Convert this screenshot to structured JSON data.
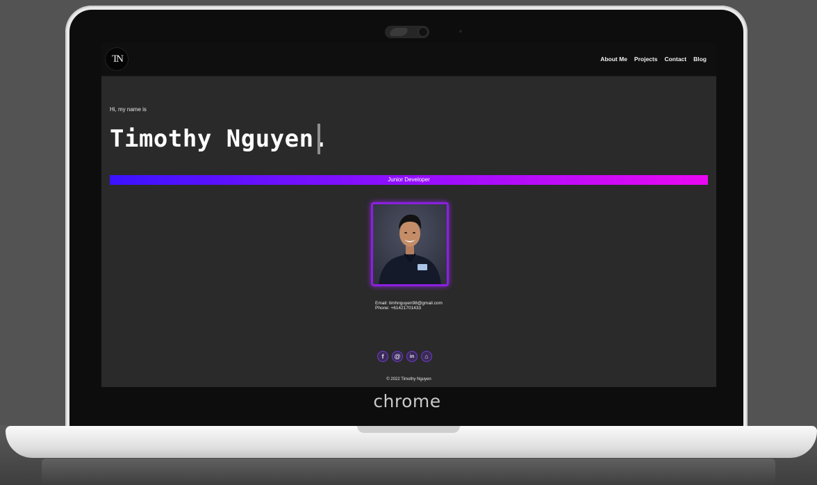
{
  "device": {
    "brand": "chrome"
  },
  "site": {
    "logo_text": "TN",
    "nav": [
      "About Me",
      "Projects",
      "Contact",
      "Blog"
    ],
    "greeting": "Hi, my name is",
    "name": "Timothy Nguyen.",
    "role": "Junior Developer",
    "contact": {
      "email": "Email: timhnguyen98@gmail.com",
      "phone": "Phone: +61421701433"
    },
    "socials": [
      {
        "icon": "facebook-icon",
        "glyph": "f"
      },
      {
        "icon": "email-at-icon",
        "glyph": "@"
      },
      {
        "icon": "linkedin-icon",
        "glyph": "in"
      },
      {
        "icon": "github-icon",
        "glyph": "⌂"
      }
    ],
    "copyright": "© 2022 Timothy Nguyen",
    "colors": {
      "background": "#2a2a2a",
      "navbar": "#0f0f0f",
      "gradient_start": "#3b12ff",
      "gradient_end": "#ea08f2",
      "photo_border": "#8c1fe0"
    }
  }
}
